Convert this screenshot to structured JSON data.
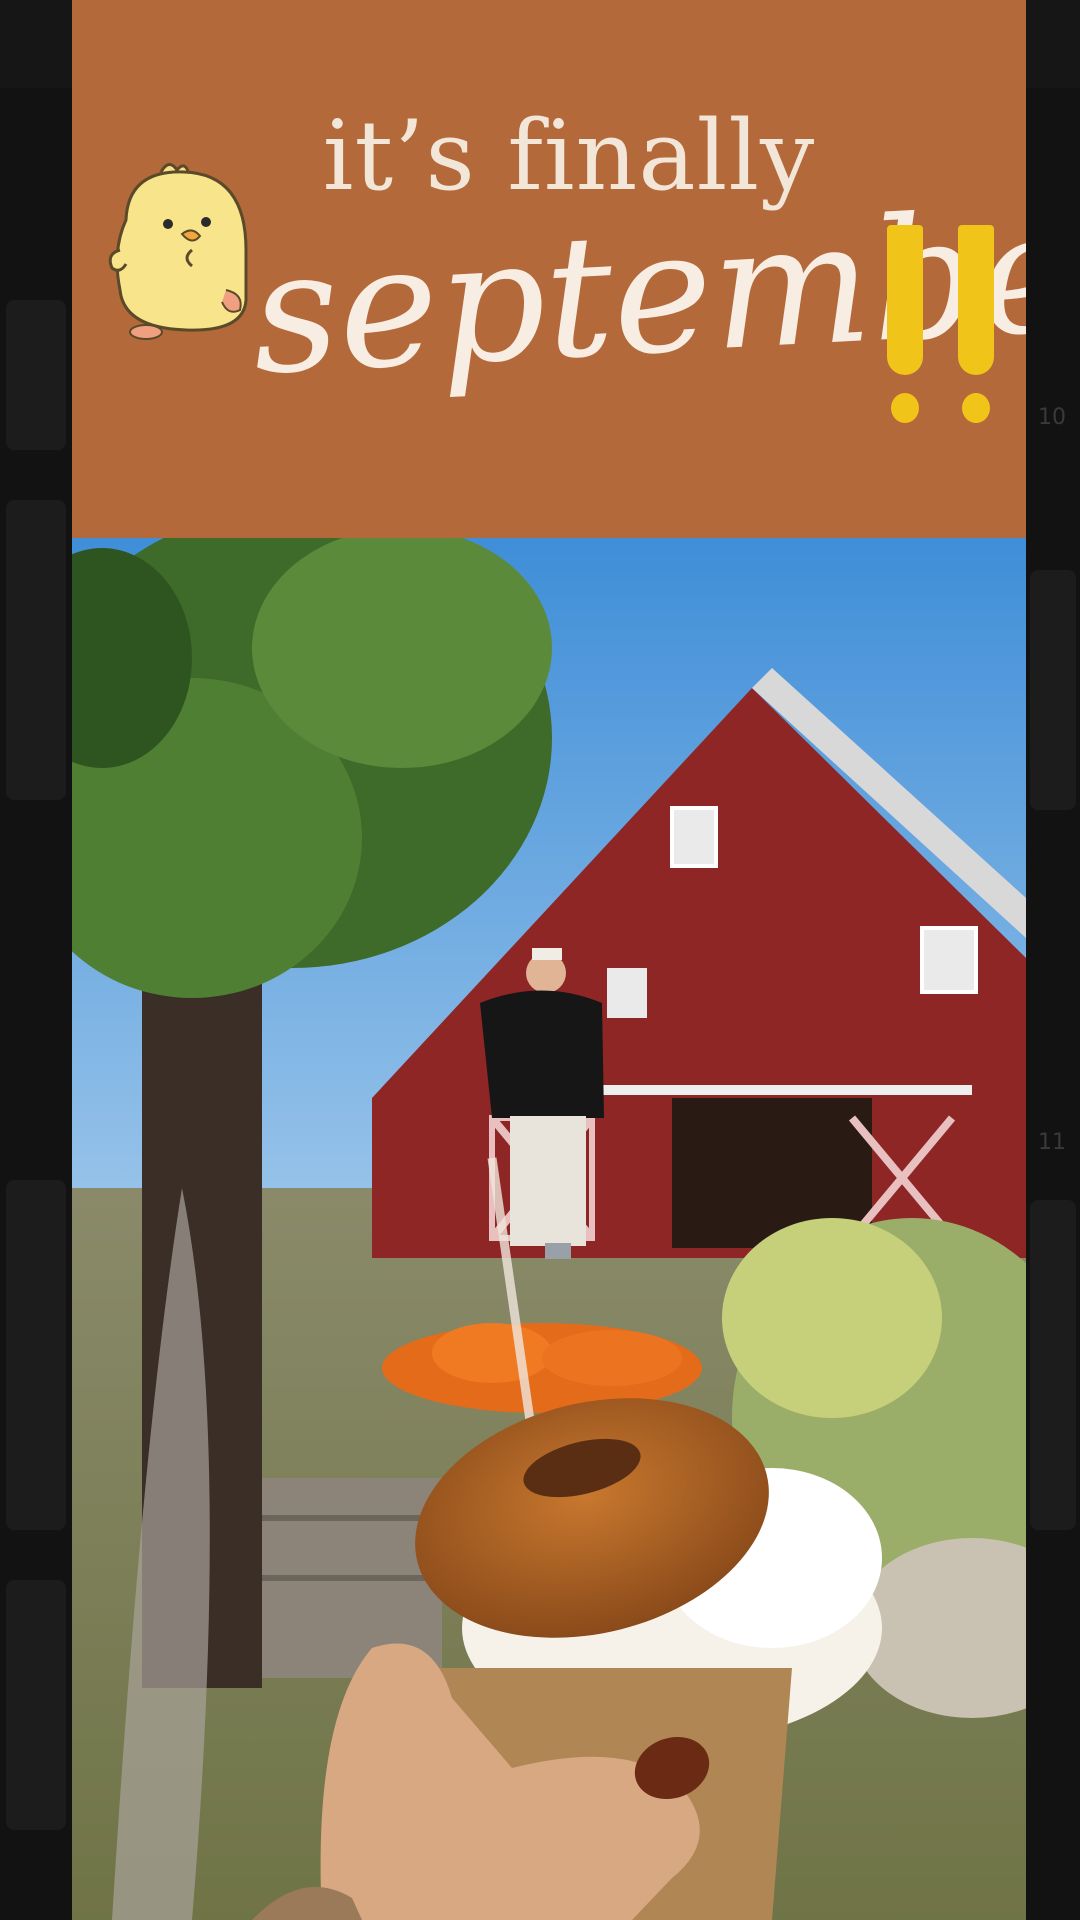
{
  "banner": {
    "line1": "it’s finally",
    "line2": "september",
    "accent_color": "#f0c419",
    "background_color": "#b4693a"
  },
  "photo": {
    "icons": [
      "chick-sticker-icon",
      "exclamation-icon"
    ]
  },
  "background_ui": {
    "side_number_top": "10",
    "side_number_bottom": "11"
  }
}
